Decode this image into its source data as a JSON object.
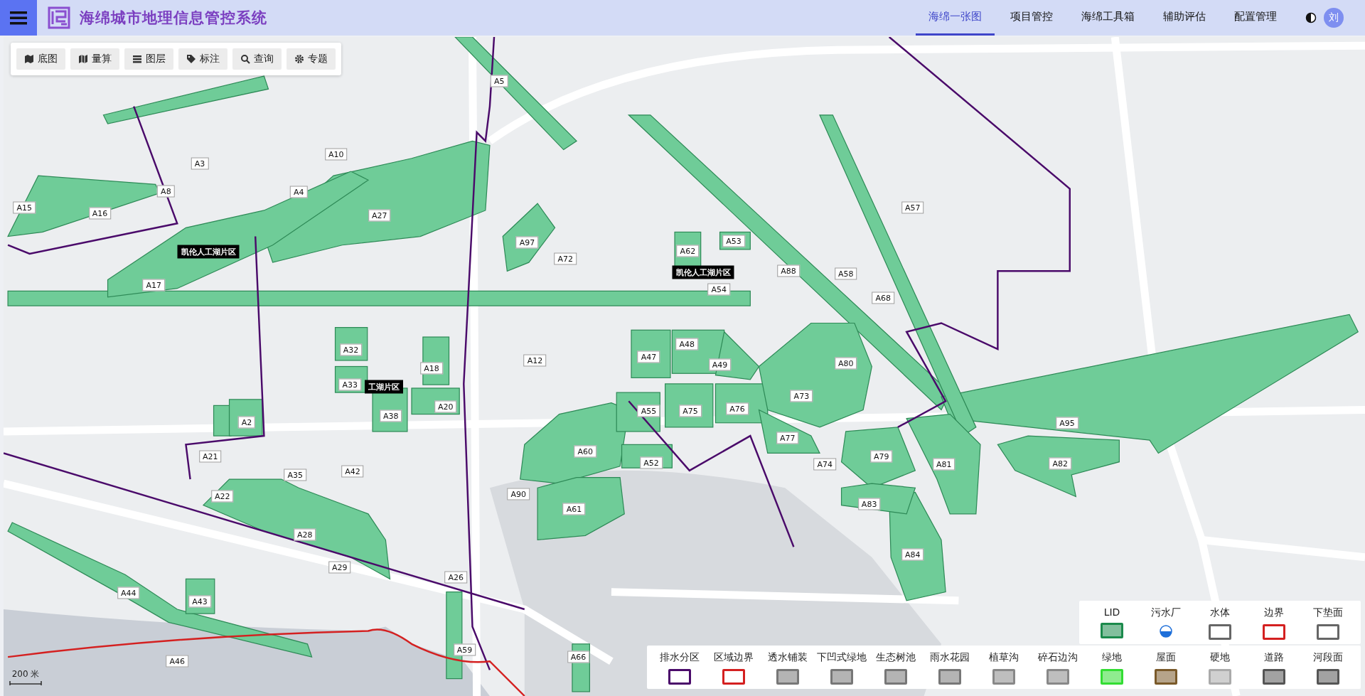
{
  "app_title": "海绵城市地理信息管控系统",
  "nav": [
    {
      "label": "海绵一张图",
      "selected": true
    },
    {
      "label": "项目管控",
      "selected": false
    },
    {
      "label": "海绵工具箱",
      "selected": false
    },
    {
      "label": "辅助评估",
      "selected": false
    },
    {
      "label": "配置管理",
      "selected": false
    }
  ],
  "user_avatar": "刘",
  "toolbar": [
    "底图",
    "量算",
    "图层",
    "标注",
    "查询",
    "专题"
  ],
  "map": {
    "zone_labels": [
      "凯伦人工湖片区",
      "凯伦人工湖片区",
      "工湖片区"
    ],
    "area_labels": [
      "A5",
      "A10",
      "A3",
      "A8",
      "A4",
      "A15",
      "A16",
      "A27",
      "A97",
      "A72",
      "A62",
      "A53",
      "A57",
      "A88",
      "A58",
      "A54",
      "A17",
      "A68",
      "A32",
      "A18",
      "A12",
      "A47",
      "A48",
      "A49",
      "A80",
      "A33",
      "A20",
      "A73",
      "A55",
      "A75",
      "A76",
      "A2",
      "A38",
      "A77",
      "A95",
      "A21",
      "A60",
      "A52",
      "A74",
      "A79",
      "A81",
      "A82",
      "A35",
      "A42",
      "A90",
      "A22",
      "A83",
      "A61",
      "A28",
      "A84",
      "A29",
      "A26",
      "A44",
      "A43",
      "A59",
      "A66",
      "A46"
    ],
    "scale": "200 米"
  },
  "legend_top": [
    {
      "label": "LID",
      "kind": "filled",
      "color": "#1b8a4c"
    },
    {
      "label": "污水厂",
      "kind": "station"
    },
    {
      "label": "水体",
      "kind": "outline",
      "color": "#666666"
    },
    {
      "label": "边界",
      "kind": "outline",
      "color": "#d42020"
    },
    {
      "label": "下垫面",
      "kind": "outline",
      "color": "#666666"
    }
  ],
  "legend_bottom": [
    {
      "label": "排水分区",
      "kind": "outline",
      "color": "#4a0a6a"
    },
    {
      "label": "区域边界",
      "kind": "outline",
      "color": "#d42020"
    },
    {
      "label": "透水铺装",
      "kind": "filled",
      "color": "#777777"
    },
    {
      "label": "下凹式绿地",
      "kind": "filled",
      "color": "#777777"
    },
    {
      "label": "生态树池",
      "kind": "filled",
      "color": "#777777"
    },
    {
      "label": "雨水花园",
      "kind": "filled",
      "color": "#777777"
    },
    {
      "label": "植草沟",
      "kind": "filled",
      "color": "#888888"
    },
    {
      "label": "碎石边沟",
      "kind": "filled",
      "color": "#888888"
    },
    {
      "label": "绿地",
      "kind": "filled",
      "color": "#33dd33"
    },
    {
      "label": "屋面",
      "kind": "filled",
      "color": "#7a5a2a"
    },
    {
      "label": "硬地",
      "kind": "filled",
      "color": "#aaaaaa"
    },
    {
      "label": "道路",
      "kind": "filled",
      "color": "#555555"
    },
    {
      "label": "河段面",
      "kind": "filled",
      "color": "#555555"
    }
  ]
}
